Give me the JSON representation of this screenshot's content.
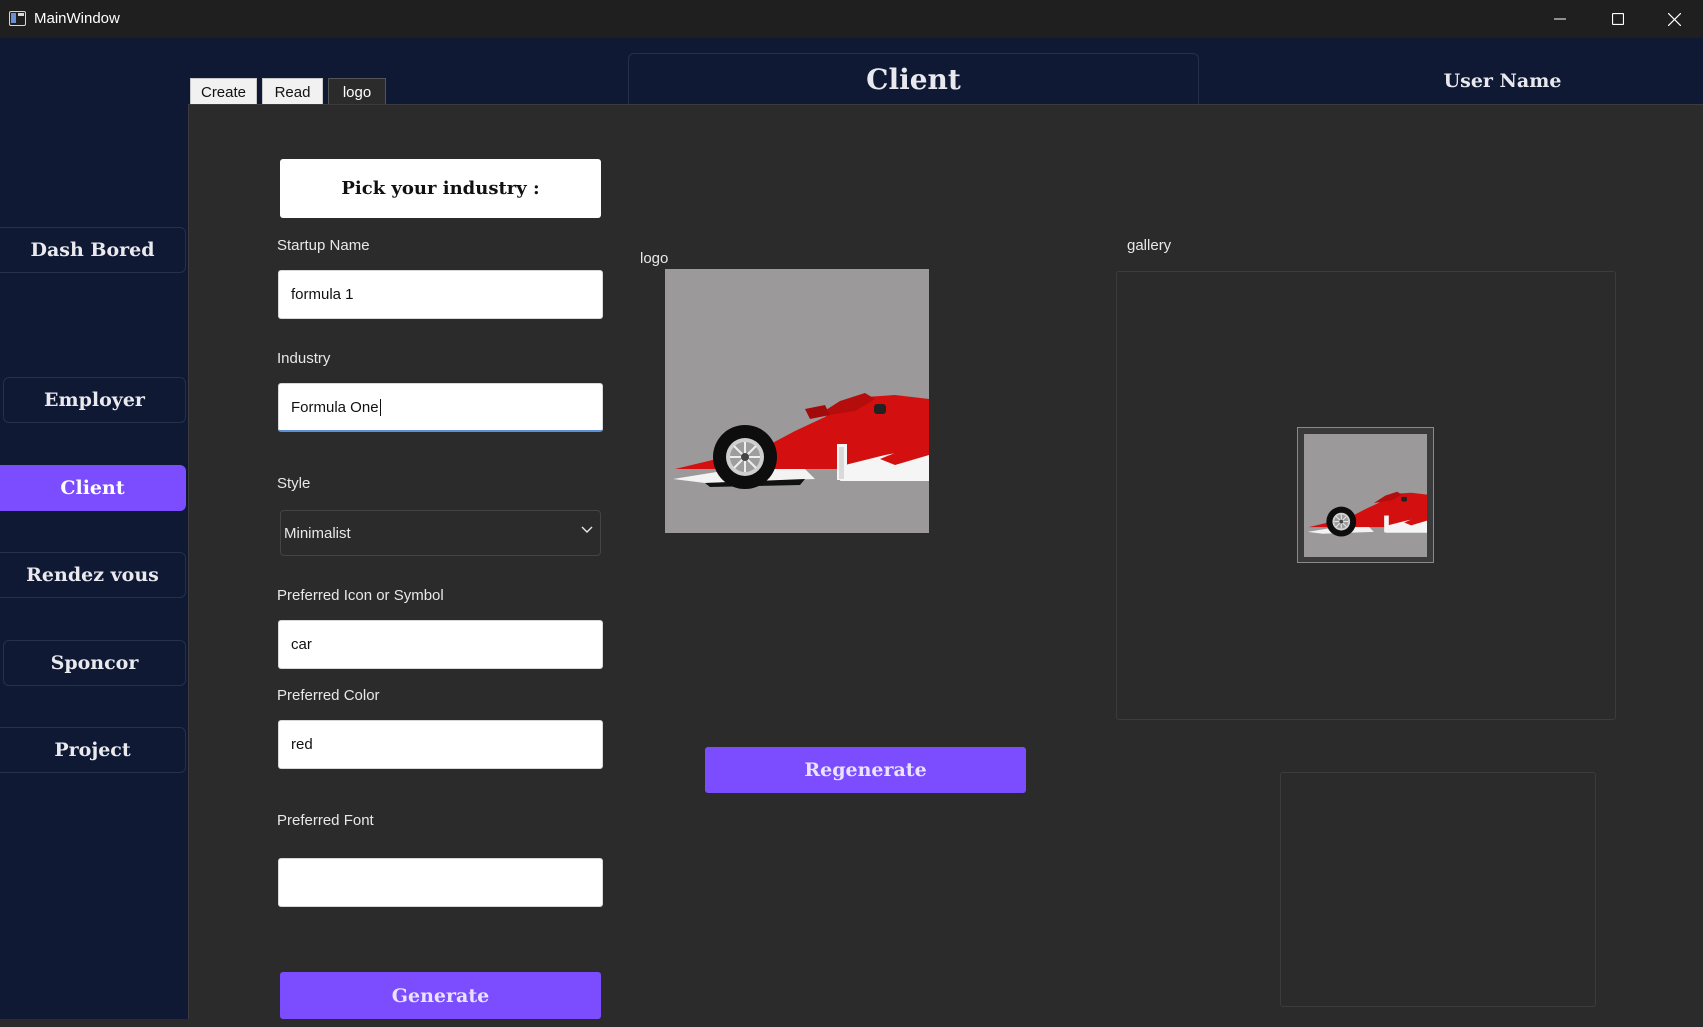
{
  "window": {
    "title": "MainWindow",
    "minimize_glyph": "minimize-icon",
    "maximize_glyph": "maximize-icon",
    "close_glyph": "close-icon"
  },
  "sidebar": {
    "items": [
      {
        "label": "Dash Bored",
        "active": false
      },
      {
        "label": "Employer",
        "active": false
      },
      {
        "label": "Client",
        "active": true
      },
      {
        "label": "Rendez vous",
        "active": false
      },
      {
        "label": "Sponcor",
        "active": false
      },
      {
        "label": "Project",
        "active": false
      }
    ],
    "active_color": "#7c4dff"
  },
  "tabs": [
    {
      "label": "Create",
      "active": false
    },
    {
      "label": "Read",
      "active": false
    },
    {
      "label": "logo",
      "active": true
    }
  ],
  "header": {
    "title": "Client",
    "user_name": "User Name"
  },
  "form": {
    "pick_industry": "Pick your industry :",
    "startup_name": {
      "label": "Startup Name",
      "value": "formula 1"
    },
    "industry": {
      "label": "Industry",
      "value": "Formula One"
    },
    "style": {
      "label": "Style",
      "value": "Minimalist"
    },
    "icon": {
      "label": "Preferred Icon or Symbol",
      "value": "car"
    },
    "color": {
      "label": "Preferred Color",
      "value": "red"
    },
    "font": {
      "label": "Preferred Font",
      "value": ""
    },
    "generate_label": "Generate"
  },
  "logo": {
    "label": "logo",
    "regenerate_label": "Regenerate"
  },
  "gallery": {
    "label": "gallery"
  },
  "colors": {
    "background": "#0f1934",
    "panel": "#2b2b2b",
    "accent": "#7c4dff"
  }
}
